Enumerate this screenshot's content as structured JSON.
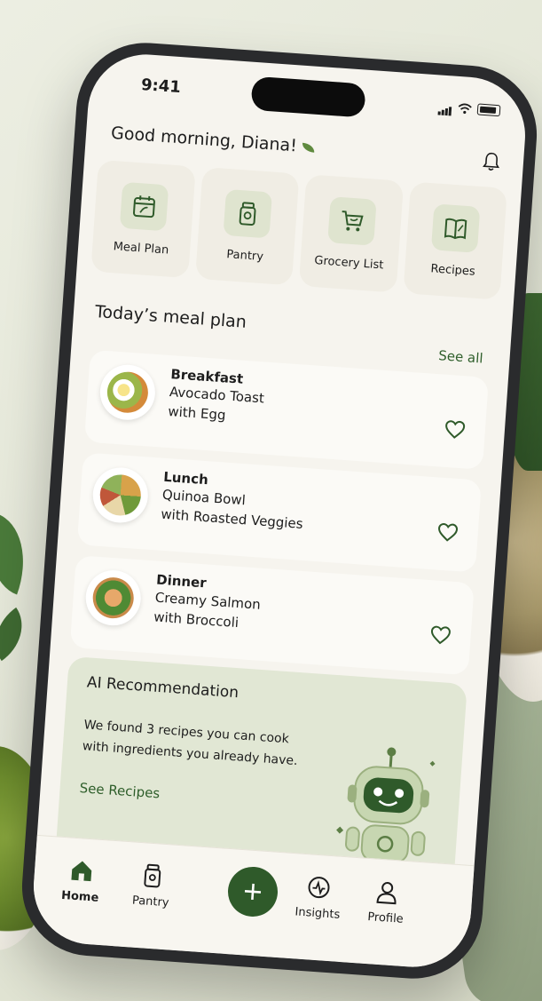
{
  "status": {
    "time": "9:41"
  },
  "greeting": "Good morning, Diana!",
  "quick_actions": [
    {
      "label": "Meal Plan",
      "icon": "calendar-icon"
    },
    {
      "label": "Pantry",
      "icon": "jar-icon"
    },
    {
      "label": "Grocery List",
      "icon": "cart-icon"
    },
    {
      "label": "Recipes",
      "icon": "book-icon"
    }
  ],
  "meal_plan": {
    "title": "Today’s meal plan",
    "see_all": "See all",
    "meals": [
      {
        "type": "Breakfast",
        "name_line1": "Avocado Toast",
        "name_line2": "with Egg"
      },
      {
        "type": "Lunch",
        "name_line1": "Quinoa Bowl",
        "name_line2": "with Roasted Veggies"
      },
      {
        "type": "Dinner",
        "name_line1": "Creamy Salmon",
        "name_line2": "with Broccoli"
      }
    ]
  },
  "ai": {
    "title": "AI Recommendation",
    "text": "We found 3 recipes you can cook with ingredients you already have.",
    "link": "See Recipes"
  },
  "nav": {
    "home": "Home",
    "pantry": "Pantry",
    "insights": "Insights",
    "profile": "Profile"
  },
  "colors": {
    "accent": "#2f5a2a",
    "card_tint": "#e1e7d4"
  }
}
